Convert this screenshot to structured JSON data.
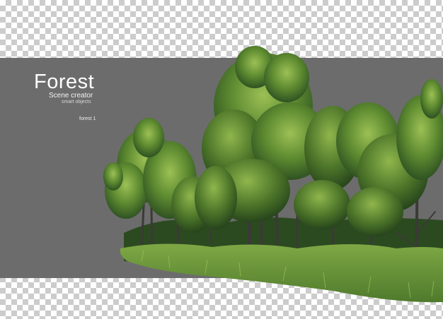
{
  "header": {
    "title": "Forest",
    "subtitle": "Scene creator",
    "tag": "smart objects",
    "label": "forest 1"
  },
  "colors": {
    "panel": "#6c6c6c",
    "checker_light": "#ffffff",
    "checker_dark": "#cccccc",
    "foliage_dark": "#2f5222",
    "foliage_mid": "#4f7a2c",
    "foliage_light": "#86ad45",
    "grass": "#6f9a3a",
    "trunk": "#3b3a36"
  },
  "image": {
    "subject": "forest-trees-icon"
  }
}
